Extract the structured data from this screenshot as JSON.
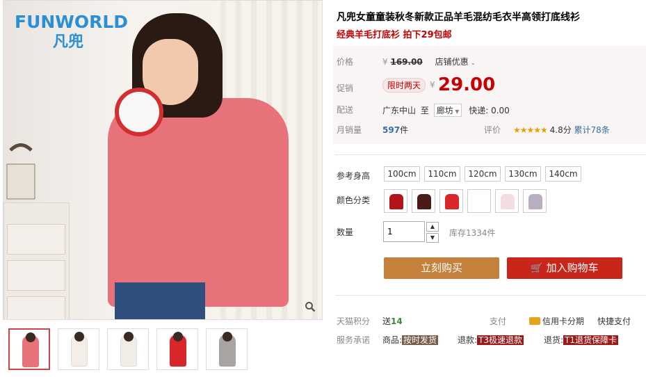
{
  "logo": {
    "text": "FUNWORLD",
    "cn": "凡兜"
  },
  "gallery": {
    "zoom_icon": "magnifier-icon",
    "thumbs": [
      {
        "color": "#e8727a"
      },
      {
        "color": "#f3efe8"
      },
      {
        "color": "#f1ede6"
      },
      {
        "color": "#d8262a"
      },
      {
        "color": "#a8a4a2"
      }
    ]
  },
  "product": {
    "title": "凡兜女童童装秋冬新款正品羊毛混纺毛衣半高领打底线衫",
    "subtitle": "经典羊毛打底衫 拍下29包邮"
  },
  "price": {
    "label": "价格",
    "currency": "¥",
    "original": "169.00",
    "store_discount": "店铺优惠"
  },
  "promo": {
    "label": "促销",
    "tag": "限时两天",
    "currency": "¥",
    "value": "29.00"
  },
  "shipping": {
    "label": "配送",
    "from": "广东中山",
    "to_word": "至",
    "dest": "廊坊",
    "express": "快递: 0.00"
  },
  "sales": {
    "label": "月销量",
    "count": "597",
    "unit": "件",
    "rating_label": "评价",
    "stars": "★★★★★",
    "score": "4.8分",
    "total": "累计78条"
  },
  "size": {
    "label": "参考身高",
    "options": [
      "100cm",
      "110cm",
      "120cm",
      "130cm",
      "140cm"
    ]
  },
  "color": {
    "label": "颜色分类",
    "swatches": [
      "#b3141a",
      "#4a1a16",
      "#d8262a",
      "#ffffff",
      "#f3dde0",
      "#b9adc0"
    ]
  },
  "quantity": {
    "label": "数量",
    "value": "1",
    "stock": "库存1334件"
  },
  "actions": {
    "buy_now": "立刻购买",
    "add_cart": "加入购物车",
    "buy_color": "#c5803b",
    "cart_color": "#c8261b"
  },
  "footer": {
    "points_label": "天猫积分",
    "points_give": "送",
    "points_value": "14",
    "pay_label": "支付",
    "credit": "信用卡分期",
    "quick": "快捷支付",
    "service_label": "服务承诺",
    "goods": "商品:",
    "goods_tag": "按时发货",
    "refund": "退款:",
    "refund_tag": "T3极速退款",
    "return": "退货:",
    "return_tag": "T1退货保障卡"
  }
}
